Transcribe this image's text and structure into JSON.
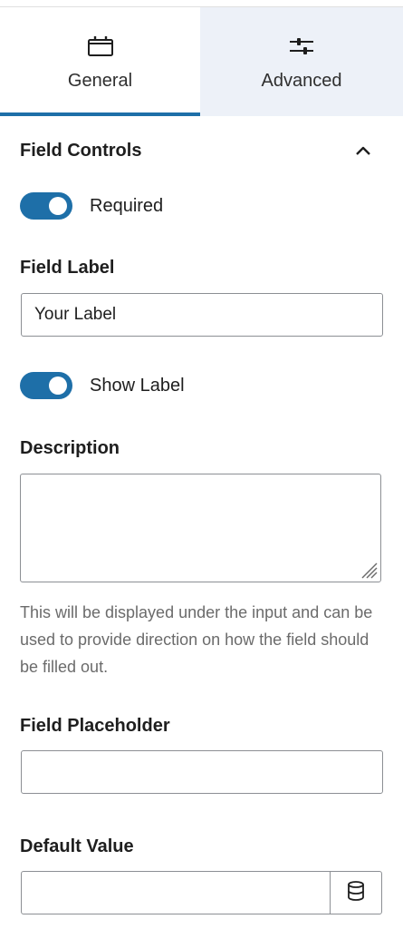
{
  "tabs": {
    "general": {
      "label": "General",
      "icon": "calendar-box-icon"
    },
    "advanced": {
      "label": "Advanced",
      "icon": "sliders-icon"
    },
    "active": "general"
  },
  "field_controls": {
    "title": "Field Controls",
    "collapse_icon": "chevron-up-icon",
    "required_label": "Required",
    "required_on": true
  },
  "field_label": {
    "title": "Field Label",
    "value": "Your Label",
    "show_label_text": "Show Label",
    "show_label_on": true
  },
  "description": {
    "title": "Description",
    "value": "",
    "help": "This will be displayed under the input and can be used to provide direction on how the field should be filled out."
  },
  "placeholder": {
    "title": "Field Placeholder",
    "value": ""
  },
  "default_value": {
    "title": "Default Value",
    "value": "",
    "icon": "database-icon"
  },
  "colors": {
    "accent": "#1e6fa8",
    "advanced_tab_bg": "#edf1f8",
    "help_text": "#6b6b6b"
  }
}
